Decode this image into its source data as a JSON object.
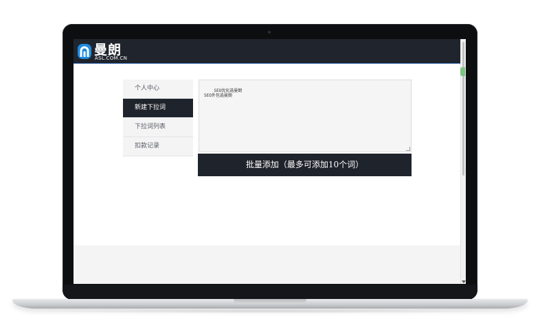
{
  "header": {
    "logo_text": "曼朗",
    "logo_subtext": "ASL.COM.CN"
  },
  "sidebar": {
    "items": [
      {
        "label": "个人中心",
        "active": false
      },
      {
        "label": "新建下拉词",
        "active": true
      },
      {
        "label": "下拉词列表",
        "active": false
      },
      {
        "label": "扣款记录",
        "active": false
      }
    ]
  },
  "main": {
    "keywords_text": "SEO优化选曼朗\nSEO外包选曼朗",
    "submit_label": "批量添加（最多可添加10个词）"
  },
  "colors": {
    "header_bg": "#20252d",
    "active_nav_bg": "#1f232b",
    "button_bg": "#1f232b",
    "logo_accent": "#1e8be0"
  },
  "icons": {
    "logo": "manlang-logo-icon",
    "scroll_down": "arrow-down-icon"
  }
}
